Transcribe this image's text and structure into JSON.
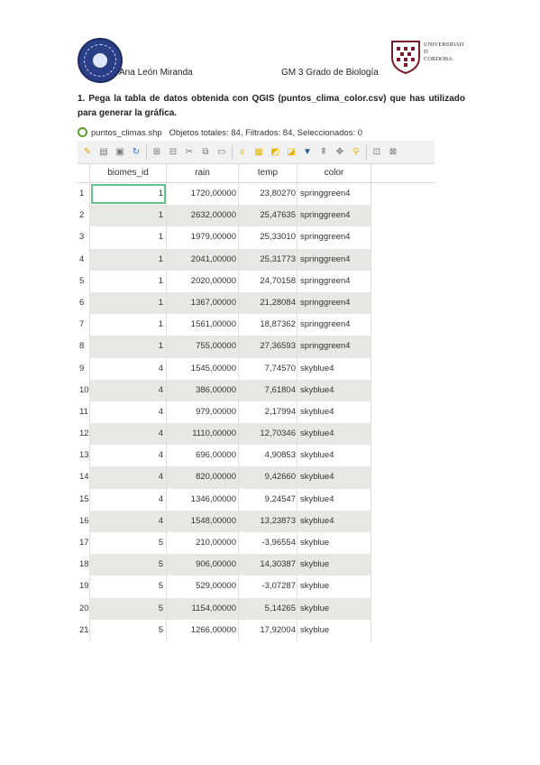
{
  "header": {
    "author": "Ana León Miranda",
    "course": "GM 3 Grado de Biología",
    "university_lines": [
      "UNIVERSIDAD",
      "D",
      "CORDOBA"
    ]
  },
  "question": "1. Pega la tabla de datos obtenida con QGIS (puntos_clima_color.csv) que has utilizado para generar la gráfica.",
  "qgis": {
    "layer": "puntos_climas.shp",
    "status": "Objetos totales: 84, Filtrados: 84, Seleccionados: 0"
  },
  "columns": [
    "biomes_id",
    "rain",
    "temp",
    "color"
  ],
  "rows": [
    {
      "i": "1",
      "b": "1",
      "r": "1720,00000",
      "t": "23,80270",
      "c": "springgreen4"
    },
    {
      "i": "2",
      "b": "1",
      "r": "2632,00000",
      "t": "25,47635",
      "c": "springgreen4"
    },
    {
      "i": "3",
      "b": "1",
      "r": "1979,00000",
      "t": "25,33010",
      "c": "springgreen4"
    },
    {
      "i": "4",
      "b": "1",
      "r": "2041,00000",
      "t": "25,31773",
      "c": "springgreen4"
    },
    {
      "i": "5",
      "b": "1",
      "r": "2020,00000",
      "t": "24,70158",
      "c": "springgreen4"
    },
    {
      "i": "6",
      "b": "1",
      "r": "1367,00000",
      "t": "21,28084",
      "c": "springgreen4"
    },
    {
      "i": "7",
      "b": "1",
      "r": "1561,00000",
      "t": "18,87362",
      "c": "springgreen4"
    },
    {
      "i": "8",
      "b": "1",
      "r": "755,00000",
      "t": "27,36593",
      "c": "springgreen4"
    },
    {
      "i": "9",
      "b": "4",
      "r": "1545,00000",
      "t": "7,74570",
      "c": "skyblue4"
    },
    {
      "i": "10",
      "b": "4",
      "r": "386,00000",
      "t": "7,61804",
      "c": "skyblue4"
    },
    {
      "i": "11",
      "b": "4",
      "r": "979,00000",
      "t": "2,17994",
      "c": "skyblue4"
    },
    {
      "i": "12",
      "b": "4",
      "r": "1110,00000",
      "t": "12,70346",
      "c": "skyblue4"
    },
    {
      "i": "13",
      "b": "4",
      "r": "696,00000",
      "t": "4,90853",
      "c": "skyblue4"
    },
    {
      "i": "14",
      "b": "4",
      "r": "820,00000",
      "t": "9,42660",
      "c": "skyblue4"
    },
    {
      "i": "15",
      "b": "4",
      "r": "1346,00000",
      "t": "9,24547",
      "c": "skyblue4"
    },
    {
      "i": "16",
      "b": "4",
      "r": "1548,00000",
      "t": "13,23873",
      "c": "skyblue4"
    },
    {
      "i": "17",
      "b": "5",
      "r": "210,00000",
      "t": "-3,96554",
      "c": "skyblue"
    },
    {
      "i": "18",
      "b": "5",
      "r": "906,00000",
      "t": "14,30387",
      "c": "skyblue"
    },
    {
      "i": "19",
      "b": "5",
      "r": "529,00000",
      "t": "-3,07287",
      "c": "skyblue"
    },
    {
      "i": "20",
      "b": "5",
      "r": "1154,00000",
      "t": "5,14265",
      "c": "skyblue"
    },
    {
      "i": "21",
      "b": "5",
      "r": "1266,00000",
      "t": "17,92004",
      "c": "skyblue"
    }
  ]
}
